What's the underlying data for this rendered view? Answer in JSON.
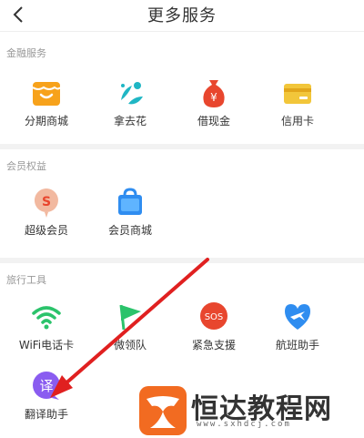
{
  "header": {
    "title": "更多服务"
  },
  "sections": [
    {
      "label": "金融服务",
      "items": [
        {
          "label": "分期商城",
          "icon": "shop-icon"
        },
        {
          "label": "拿去花",
          "icon": "flower-icon"
        },
        {
          "label": "借现金",
          "icon": "money-bag-icon"
        },
        {
          "label": "信用卡",
          "icon": "credit-card-icon"
        }
      ]
    },
    {
      "label": "会员权益",
      "items": [
        {
          "label": "超级会员",
          "icon": "super-member-icon"
        },
        {
          "label": "会员商城",
          "icon": "shopping-bag-icon"
        }
      ]
    },
    {
      "label": "旅行工具",
      "items": [
        {
          "label": "WiFi电话卡",
          "icon": "wifi-icon"
        },
        {
          "label": "微领队",
          "icon": "flag-icon"
        },
        {
          "label": "紧急支援",
          "icon": "sos-icon"
        },
        {
          "label": "航班助手",
          "icon": "flight-icon"
        },
        {
          "label": "翻译助手",
          "icon": "translate-icon"
        }
      ]
    }
  ],
  "watermark": {
    "text": "恒达教程网",
    "url": "www.sxhdcj.com"
  },
  "colors": {
    "accent_orange": "#f7a21b",
    "accent_green": "#2bc36b",
    "accent_red": "#e8462e",
    "accent_blue": "#2f8df0",
    "accent_purple": "#8a5cf0",
    "arrow_red": "#e02020"
  }
}
